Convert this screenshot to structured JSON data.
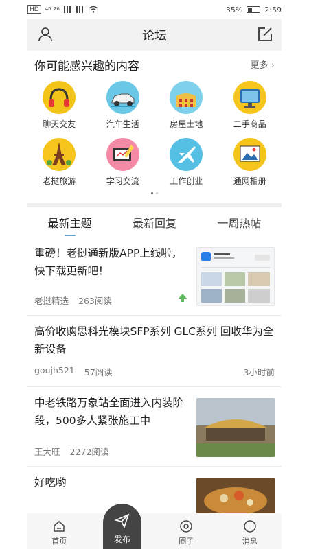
{
  "status_bar": {
    "left_indicators": "⁴⁶ ²⁶",
    "battery": "35%",
    "time": "2:59"
  },
  "header": {
    "title": "论坛"
  },
  "interest": {
    "title": "你可能感兴趣的内容",
    "more": "更多",
    "categories": [
      {
        "label": "聊天交友",
        "icon": "headphones-icon",
        "color": "#f2c318"
      },
      {
        "label": "汽车生活",
        "icon": "car-icon",
        "color": "#6bc7e6"
      },
      {
        "label": "房屋土地",
        "icon": "building-icon",
        "color": "#7fd0ea"
      },
      {
        "label": "二手商品",
        "icon": "monitor-icon",
        "color": "#f5c51e"
      },
      {
        "label": "老挝旅游",
        "icon": "eiffel-tower-icon",
        "color": "#f5c51e"
      },
      {
        "label": "学习交流",
        "icon": "drawing-tablet-icon",
        "color": "#f58aa6"
      },
      {
        "label": "工作创业",
        "icon": "airplane-icon",
        "color": "#55c0e4"
      },
      {
        "label": "通网相册",
        "icon": "photo-album-icon",
        "color": "#f5c51e"
      }
    ]
  },
  "tabs": [
    "最新主题",
    "最新回复",
    "一周热帖"
  ],
  "posts": [
    {
      "title": "重磅！老挝通新版APP上线啦，快下载更新吧！",
      "author": "老挝精选",
      "reads": "263阅读",
      "has_thumb": true
    },
    {
      "title": "高价收购思科光模块SFP系列 GLC系列 回收华为全新设备",
      "author": "goujh521",
      "reads": "57阅读",
      "time": "3小时前"
    },
    {
      "title": "中老铁路万象站全面进入内装阶段，500多人紧张施工中",
      "author": "王大旺",
      "reads": "2272阅读",
      "has_thumb": true
    },
    {
      "title": "好吃哟",
      "has_thumb": true
    }
  ],
  "bottom_nav": {
    "home": "首页",
    "publish": "发布",
    "circle": "圈子",
    "message": "消息"
  }
}
